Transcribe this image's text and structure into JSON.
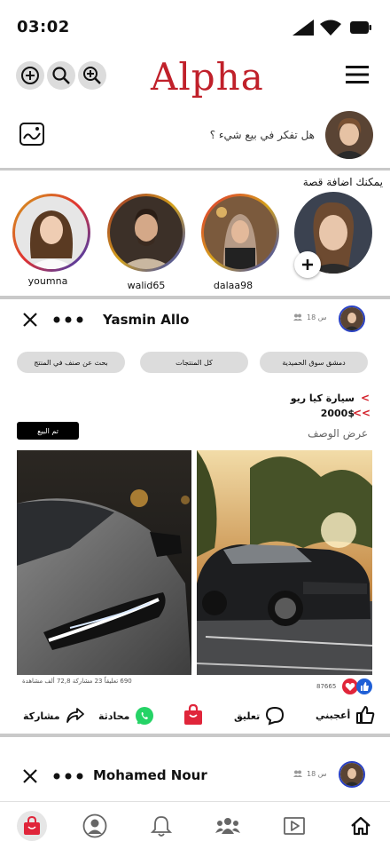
{
  "status_bar": {
    "time": "03:02"
  },
  "header": {
    "logo": "Alpha",
    "icons": [
      "zoom-reset-icon",
      "search-icon",
      "zoom-in-icon",
      "menu-icon"
    ]
  },
  "composer": {
    "prompt": "هل تفكر في بيع شيء ؟"
  },
  "stories": {
    "title": "يمكنك اضافة قصة",
    "items": [
      {
        "name": "youmna",
        "ring": "#d4a21b"
      },
      {
        "name": "walid65",
        "ring": "#9a2a2a"
      },
      {
        "name": "dalaa98",
        "ring": "#c8382e"
      }
    ]
  },
  "posts": [
    {
      "author": "Yasmin Allo",
      "meta": "18 س",
      "chips": [
        "دمشق سوق الحميدية",
        "كل المنتجات",
        "بحث عن صنف في المنتج"
      ],
      "sold_label": "تم البيع",
      "title": "سيارة كيا ريو",
      "price": "2000$",
      "description_link": "عرض الوصف",
      "stats": "690 تعليقاً 23 مشاركة 72,8 ألف مشاهدة",
      "likes": "87665",
      "actions": {
        "like": "أعجبني",
        "comment": "تعليق",
        "chat": "محادثة",
        "share": "مشاركة"
      }
    },
    {
      "author": "Mohamed Nour",
      "meta": "18 س"
    }
  ],
  "colors": {
    "brand": "#c0202a",
    "like_red": "#e0253a",
    "like_blue": "#1f5fd6",
    "whatsapp": "#25d366"
  },
  "bottom_nav": [
    "home-icon",
    "video-icon",
    "groups-icon",
    "bell-icon",
    "profile-icon",
    "shop-icon"
  ]
}
